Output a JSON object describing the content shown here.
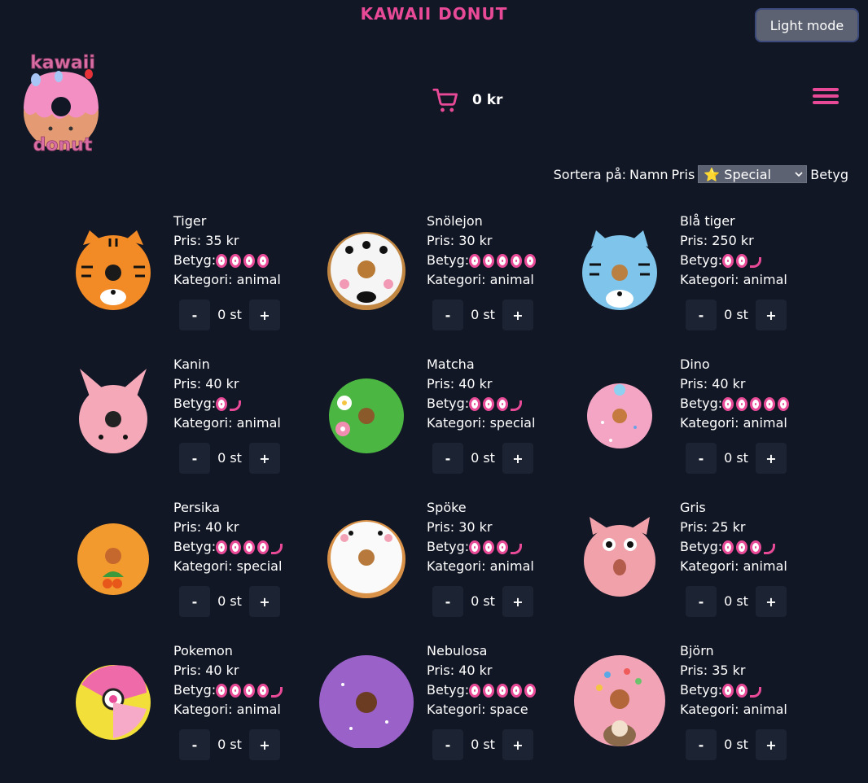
{
  "header": {
    "title": "KAWAII DONUT",
    "mode_label": "Light mode",
    "logo_text_top": "kawaii",
    "logo_text_bottom": "donut"
  },
  "cart": {
    "total": "0 kr",
    "icon": "cart-icon"
  },
  "menu": {
    "icon": "hamburger-menu-icon"
  },
  "sort": {
    "label": "Sortera på:",
    "options": [
      "Namn",
      "Pris"
    ],
    "selected": "Special",
    "selected_icon": "⭐",
    "after": "Betyg"
  },
  "labels": {
    "price": "Pris:",
    "rating": "Betyg:",
    "category": "Kategori:",
    "minus": "-",
    "plus": "+"
  },
  "colors": {
    "accent": "#e84a97",
    "background": "#121726",
    "button": "#1c2333"
  },
  "products": [
    {
      "name": "Tiger",
      "price": "35 kr",
      "rating": 4,
      "category": "animal",
      "qty": "0 st"
    },
    {
      "name": "Snölejon",
      "price": "30 kr",
      "rating": 5,
      "category": "animal",
      "qty": "0 st"
    },
    {
      "name": "Blå tiger",
      "price": "250 kr",
      "rating": 2.5,
      "category": "animal",
      "qty": "0 st"
    },
    {
      "name": "Kanin",
      "price": "40 kr",
      "rating": 1.5,
      "category": "animal",
      "qty": "0 st"
    },
    {
      "name": "Matcha",
      "price": "40 kr",
      "rating": 3.5,
      "category": "special",
      "qty": "0 st"
    },
    {
      "name": "Dino",
      "price": "40 kr",
      "rating": 5,
      "category": "animal",
      "qty": "0 st"
    },
    {
      "name": "Persika",
      "price": "40 kr",
      "rating": 4.5,
      "category": "special",
      "qty": "0 st"
    },
    {
      "name": "Spöke",
      "price": "30 kr",
      "rating": 3.5,
      "category": "animal",
      "qty": "0 st"
    },
    {
      "name": "Gris",
      "price": "25 kr",
      "rating": 3.5,
      "category": "animal",
      "qty": "0 st"
    },
    {
      "name": "Pokemon",
      "price": "40 kr",
      "rating": 4.5,
      "category": "animal",
      "qty": "0 st"
    },
    {
      "name": "Nebulosa",
      "price": "40 kr",
      "rating": 5,
      "category": "space",
      "qty": "0 st"
    },
    {
      "name": "Björn",
      "price": "35 kr",
      "rating": 2.5,
      "category": "animal",
      "qty": "0 st"
    }
  ]
}
